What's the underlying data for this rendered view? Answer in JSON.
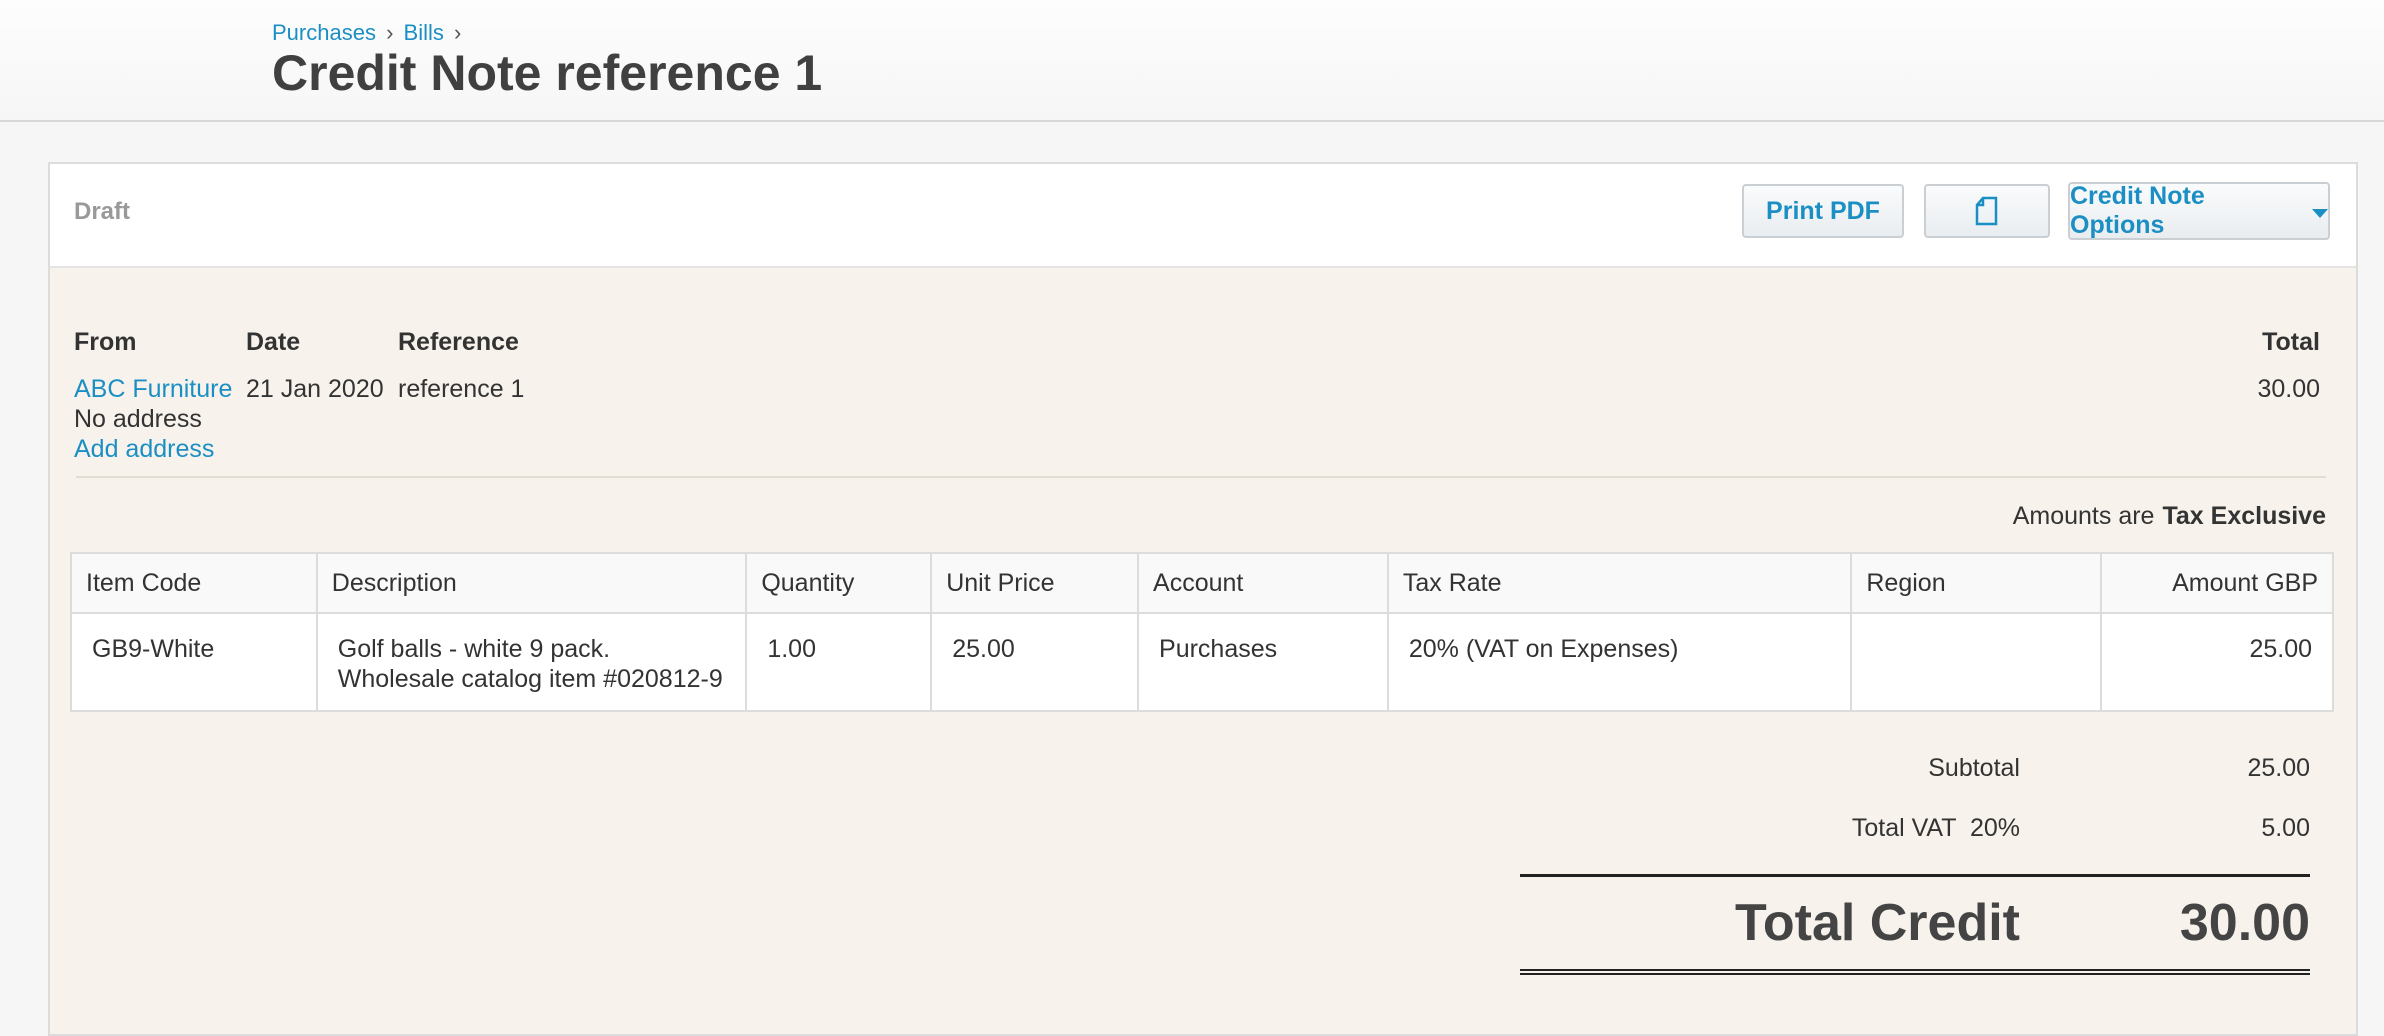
{
  "breadcrumb": {
    "purchases": "Purchases",
    "bills": "Bills",
    "sep": "›"
  },
  "page_title": "Credit Note reference 1",
  "toolbar": {
    "status": "Draft",
    "print_pdf": "Print PDF",
    "copy_icon": "document-copy-icon",
    "options": "Credit Note Options"
  },
  "info": {
    "from_label": "From",
    "date_label": "Date",
    "reference_label": "Reference",
    "total_label": "Total",
    "from_name": "ABC Furniture",
    "no_address": "No address",
    "add_address": "Add address",
    "date": "21 Jan 2020",
    "reference": "reference 1",
    "total": "30.00"
  },
  "amounts_are": {
    "label": "Amounts are",
    "value": "Tax Exclusive"
  },
  "table": {
    "headers": [
      "Item Code",
      "Description",
      "Quantity",
      "Unit Price",
      "Account",
      "Tax Rate",
      "Region",
      "Amount GBP"
    ],
    "rows": [
      {
        "item_code": "GB9-White",
        "description": "Golf balls - white 9 pack. Wholesale catalog item #020812-9",
        "quantity": "1.00",
        "unit_price": "25.00",
        "account": "Purchases",
        "tax_rate": "20% (VAT on Expenses)",
        "region": "",
        "amount": "25.00"
      }
    ]
  },
  "totals": {
    "subtotal_label": "Subtotal",
    "subtotal": "25.00",
    "vat_label": "Total VAT  20%",
    "vat": "5.00",
    "total_label": "Total Credit",
    "total": "30.00"
  },
  "colors": {
    "link": "#1b8fc4",
    "panel_bg": "#f7f3ec"
  }
}
